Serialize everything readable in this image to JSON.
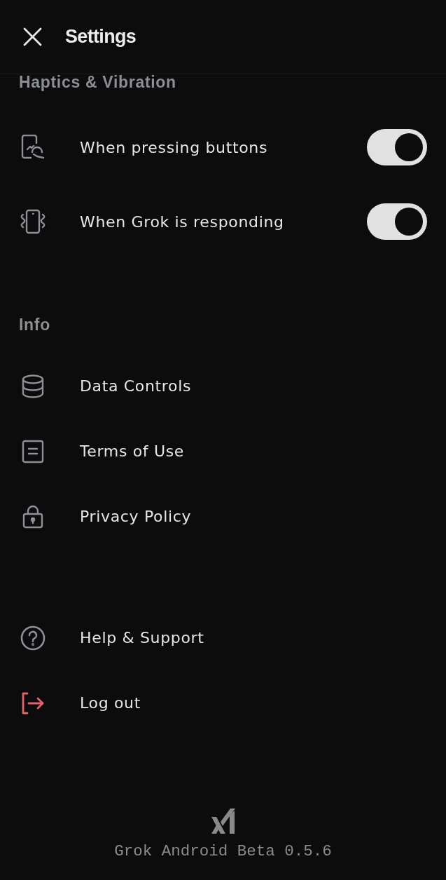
{
  "header": {
    "title": "Settings"
  },
  "sections": [
    {
      "title": "Haptics & Vibration",
      "items": [
        {
          "kind": "toggle",
          "label": "When pressing buttons",
          "on": true
        },
        {
          "kind": "toggle",
          "label": "When Grok is responding",
          "on": true
        }
      ]
    },
    {
      "title": "Info",
      "items": [
        {
          "kind": "link",
          "label": "Data Controls"
        },
        {
          "kind": "link",
          "label": "Terms of Use"
        },
        {
          "kind": "link",
          "label": "Privacy Policy"
        }
      ]
    },
    {
      "items": [
        {
          "kind": "link",
          "label": "Help & Support"
        },
        {
          "kind": "destructive",
          "label": "Log out"
        }
      ]
    }
  ],
  "footer": {
    "version": "Grok Android Beta 0.5.6"
  }
}
